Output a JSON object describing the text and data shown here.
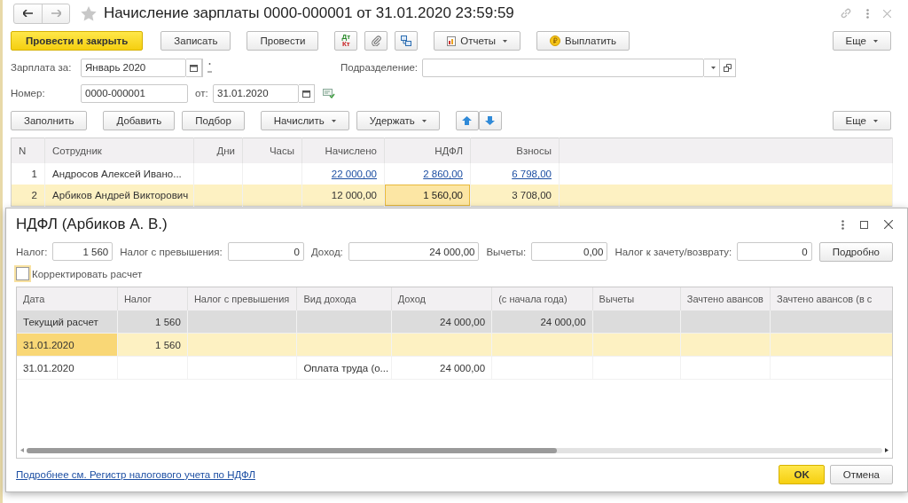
{
  "window": {
    "title": "Начисление зарплаты 0000-000001 от 31.01.2020 23:59:59"
  },
  "command_bar": {
    "buttons": [
      {
        "kind": "primary",
        "label": "Провести и закрыть"
      },
      {
        "kind": "button",
        "label": "Записать"
      },
      {
        "kind": "button",
        "label": "Провести"
      },
      {
        "kind": "dtkt",
        "top": "Дт",
        "bottom": "Кт"
      },
      {
        "kind": "clip"
      },
      {
        "kind": "structure"
      },
      {
        "kind": "report-menu",
        "label": "Отчеты"
      },
      {
        "kind": "coin",
        "label": "Выплатить"
      }
    ],
    "more": "Еще"
  },
  "fields": {
    "period_label": "Зарплата за:",
    "period": "Январь 2020",
    "department_label": "Подразделение:",
    "number_label": "Номер:",
    "number": "0000-000001",
    "date_label": "от:",
    "date": "31.01.2020"
  },
  "table_bar": {
    "buttons": [
      {
        "kind": "button",
        "label": "Заполнить"
      },
      {
        "kind": "button",
        "label": "Добавить"
      },
      {
        "kind": "button",
        "label": "Подбор"
      },
      {
        "kind": "menu",
        "label": "Начислить"
      },
      {
        "kind": "menu",
        "label": "Удержать"
      },
      {
        "kind": "up"
      },
      {
        "kind": "down"
      }
    ],
    "more": "Еще"
  },
  "table": {
    "columns": [
      "N",
      "Сотрудник",
      "Дни",
      "Часы",
      "Начислено",
      "НДФЛ",
      "Взносы"
    ],
    "rows": [
      {
        "selected": false,
        "linked": true,
        "ndfl_focused": false,
        "n": "1",
        "employee": "Андросов Алексей Ивано...",
        "accrued": "22 000,00",
        "ndfl": "2 860,00",
        "contributions": "6 798,00"
      },
      {
        "selected": true,
        "linked": false,
        "ndfl_focused": true,
        "n": "2",
        "employee": "Арбиков Андрей Викторович",
        "accrued": "12 000,00",
        "ndfl": "1 560,00",
        "contributions": "3 708,00"
      }
    ]
  },
  "dialog": {
    "title": "НДФЛ (Арбиков А. В.)",
    "fields": [
      {
        "label": "Налог:",
        "value": "1 560"
      },
      {
        "label": "Налог с превышения:",
        "value": "0"
      },
      {
        "label": "Доход:",
        "value": "24 000,00"
      },
      {
        "label": "Вычеты:",
        "value": "0,00"
      },
      {
        "label": "Налог к зачету/возврату:",
        "value": "0"
      }
    ],
    "details_button": "Подробно",
    "checkbox": {
      "label": "Корректировать расчет",
      "checked": false
    },
    "table": {
      "columns": [
        "Дата",
        "Налог",
        "Налог с превышения",
        "Вид дохода",
        "Доход",
        "(с начала года)",
        "Вычеты",
        "Зачтено авансов",
        "Зачтено авансов (в с"
      ],
      "rows": [
        {
          "kind": "total",
          "selected": false,
          "date": "Текущий расчет",
          "tax": "1 560",
          "income": "24 000,00",
          "income_ytd": "24 000,00"
        },
        {
          "kind": "detail",
          "selected": true,
          "date": "31.01.2020",
          "tax": "1 560"
        },
        {
          "kind": "detail",
          "selected": false,
          "date": "31.01.2020",
          "income_type": "Оплата труда (о...",
          "income": "24 000,00"
        }
      ]
    },
    "link": "Подробнее см. Регистр налогового учета по НДФЛ",
    "ok": "OK",
    "cancel": "Отмена"
  }
}
